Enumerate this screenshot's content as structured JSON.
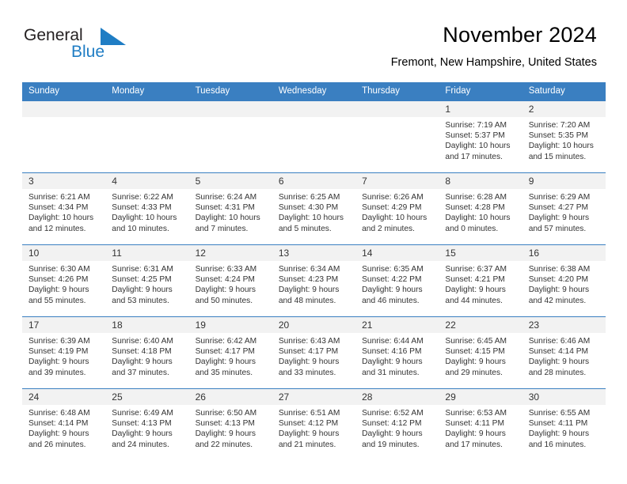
{
  "brand": {
    "name_part1": "General",
    "name_part2": "Blue",
    "logo_icon": "triangle-logo-icon"
  },
  "header": {
    "title": "November 2024",
    "location": "Fremont, New Hampshire, United States"
  },
  "calendar": {
    "weekday_headers": [
      "Sunday",
      "Monday",
      "Tuesday",
      "Wednesday",
      "Thursday",
      "Friday",
      "Saturday"
    ],
    "accent_color": "#3a7fc1",
    "daynum_background": "#f2f2f2",
    "weeks": [
      [
        {
          "empty": true
        },
        {
          "empty": true
        },
        {
          "empty": true
        },
        {
          "empty": true
        },
        {
          "empty": true
        },
        {
          "day": "1",
          "sunrise": "Sunrise: 7:19 AM",
          "sunset": "Sunset: 5:37 PM",
          "daylight": "Daylight: 10 hours and 17 minutes."
        },
        {
          "day": "2",
          "sunrise": "Sunrise: 7:20 AM",
          "sunset": "Sunset: 5:35 PM",
          "daylight": "Daylight: 10 hours and 15 minutes."
        }
      ],
      [
        {
          "day": "3",
          "sunrise": "Sunrise: 6:21 AM",
          "sunset": "Sunset: 4:34 PM",
          "daylight": "Daylight: 10 hours and 12 minutes."
        },
        {
          "day": "4",
          "sunrise": "Sunrise: 6:22 AM",
          "sunset": "Sunset: 4:33 PM",
          "daylight": "Daylight: 10 hours and 10 minutes."
        },
        {
          "day": "5",
          "sunrise": "Sunrise: 6:24 AM",
          "sunset": "Sunset: 4:31 PM",
          "daylight": "Daylight: 10 hours and 7 minutes."
        },
        {
          "day": "6",
          "sunrise": "Sunrise: 6:25 AM",
          "sunset": "Sunset: 4:30 PM",
          "daylight": "Daylight: 10 hours and 5 minutes."
        },
        {
          "day": "7",
          "sunrise": "Sunrise: 6:26 AM",
          "sunset": "Sunset: 4:29 PM",
          "daylight": "Daylight: 10 hours and 2 minutes."
        },
        {
          "day": "8",
          "sunrise": "Sunrise: 6:28 AM",
          "sunset": "Sunset: 4:28 PM",
          "daylight": "Daylight: 10 hours and 0 minutes."
        },
        {
          "day": "9",
          "sunrise": "Sunrise: 6:29 AM",
          "sunset": "Sunset: 4:27 PM",
          "daylight": "Daylight: 9 hours and 57 minutes."
        }
      ],
      [
        {
          "day": "10",
          "sunrise": "Sunrise: 6:30 AM",
          "sunset": "Sunset: 4:26 PM",
          "daylight": "Daylight: 9 hours and 55 minutes."
        },
        {
          "day": "11",
          "sunrise": "Sunrise: 6:31 AM",
          "sunset": "Sunset: 4:25 PM",
          "daylight": "Daylight: 9 hours and 53 minutes."
        },
        {
          "day": "12",
          "sunrise": "Sunrise: 6:33 AM",
          "sunset": "Sunset: 4:24 PM",
          "daylight": "Daylight: 9 hours and 50 minutes."
        },
        {
          "day": "13",
          "sunrise": "Sunrise: 6:34 AM",
          "sunset": "Sunset: 4:23 PM",
          "daylight": "Daylight: 9 hours and 48 minutes."
        },
        {
          "day": "14",
          "sunrise": "Sunrise: 6:35 AM",
          "sunset": "Sunset: 4:22 PM",
          "daylight": "Daylight: 9 hours and 46 minutes."
        },
        {
          "day": "15",
          "sunrise": "Sunrise: 6:37 AM",
          "sunset": "Sunset: 4:21 PM",
          "daylight": "Daylight: 9 hours and 44 minutes."
        },
        {
          "day": "16",
          "sunrise": "Sunrise: 6:38 AM",
          "sunset": "Sunset: 4:20 PM",
          "daylight": "Daylight: 9 hours and 42 minutes."
        }
      ],
      [
        {
          "day": "17",
          "sunrise": "Sunrise: 6:39 AM",
          "sunset": "Sunset: 4:19 PM",
          "daylight": "Daylight: 9 hours and 39 minutes."
        },
        {
          "day": "18",
          "sunrise": "Sunrise: 6:40 AM",
          "sunset": "Sunset: 4:18 PM",
          "daylight": "Daylight: 9 hours and 37 minutes."
        },
        {
          "day": "19",
          "sunrise": "Sunrise: 6:42 AM",
          "sunset": "Sunset: 4:17 PM",
          "daylight": "Daylight: 9 hours and 35 minutes."
        },
        {
          "day": "20",
          "sunrise": "Sunrise: 6:43 AM",
          "sunset": "Sunset: 4:17 PM",
          "daylight": "Daylight: 9 hours and 33 minutes."
        },
        {
          "day": "21",
          "sunrise": "Sunrise: 6:44 AM",
          "sunset": "Sunset: 4:16 PM",
          "daylight": "Daylight: 9 hours and 31 minutes."
        },
        {
          "day": "22",
          "sunrise": "Sunrise: 6:45 AM",
          "sunset": "Sunset: 4:15 PM",
          "daylight": "Daylight: 9 hours and 29 minutes."
        },
        {
          "day": "23",
          "sunrise": "Sunrise: 6:46 AM",
          "sunset": "Sunset: 4:14 PM",
          "daylight": "Daylight: 9 hours and 28 minutes."
        }
      ],
      [
        {
          "day": "24",
          "sunrise": "Sunrise: 6:48 AM",
          "sunset": "Sunset: 4:14 PM",
          "daylight": "Daylight: 9 hours and 26 minutes."
        },
        {
          "day": "25",
          "sunrise": "Sunrise: 6:49 AM",
          "sunset": "Sunset: 4:13 PM",
          "daylight": "Daylight: 9 hours and 24 minutes."
        },
        {
          "day": "26",
          "sunrise": "Sunrise: 6:50 AM",
          "sunset": "Sunset: 4:13 PM",
          "daylight": "Daylight: 9 hours and 22 minutes."
        },
        {
          "day": "27",
          "sunrise": "Sunrise: 6:51 AM",
          "sunset": "Sunset: 4:12 PM",
          "daylight": "Daylight: 9 hours and 21 minutes."
        },
        {
          "day": "28",
          "sunrise": "Sunrise: 6:52 AM",
          "sunset": "Sunset: 4:12 PM",
          "daylight": "Daylight: 9 hours and 19 minutes."
        },
        {
          "day": "29",
          "sunrise": "Sunrise: 6:53 AM",
          "sunset": "Sunset: 4:11 PM",
          "daylight": "Daylight: 9 hours and 17 minutes."
        },
        {
          "day": "30",
          "sunrise": "Sunrise: 6:55 AM",
          "sunset": "Sunset: 4:11 PM",
          "daylight": "Daylight: 9 hours and 16 minutes."
        }
      ]
    ]
  }
}
